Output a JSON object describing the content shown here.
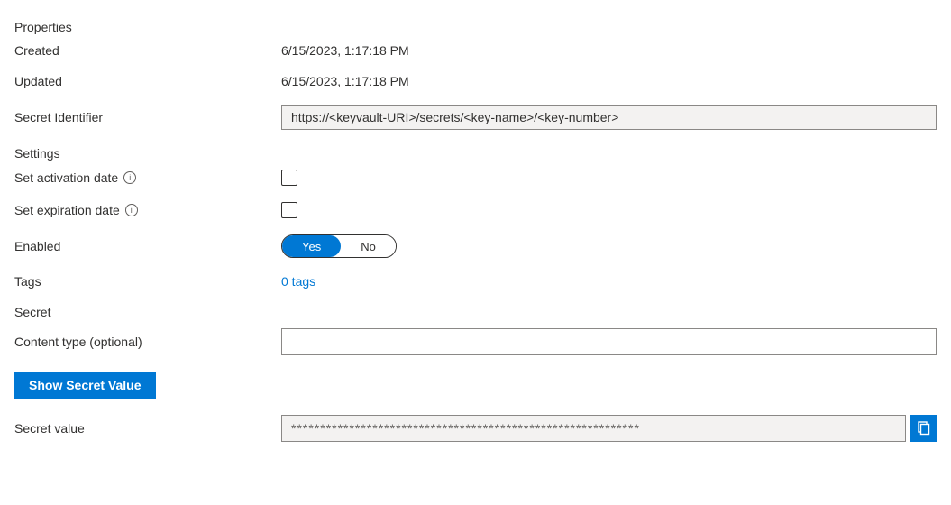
{
  "sections": {
    "properties": "Properties",
    "settings": "Settings",
    "secret": "Secret"
  },
  "properties": {
    "created_label": "Created",
    "created_value": "6/15/2023, 1:17:18 PM",
    "updated_label": "Updated",
    "updated_value": "6/15/2023, 1:17:18 PM",
    "identifier_label": "Secret Identifier",
    "identifier_value": "https://<keyvault-URI>/secrets/<key-name>/<key-number>"
  },
  "settings": {
    "activation_label": "Set activation date",
    "expiration_label": "Set expiration date",
    "enabled_label": "Enabled",
    "enabled_yes": "Yes",
    "enabled_no": "No",
    "tags_label": "Tags",
    "tags_value": "0 tags"
  },
  "secret": {
    "content_type_label": "Content type (optional)",
    "show_btn": "Show Secret Value",
    "value_label": "Secret value",
    "masked_value": "************************************************************"
  }
}
